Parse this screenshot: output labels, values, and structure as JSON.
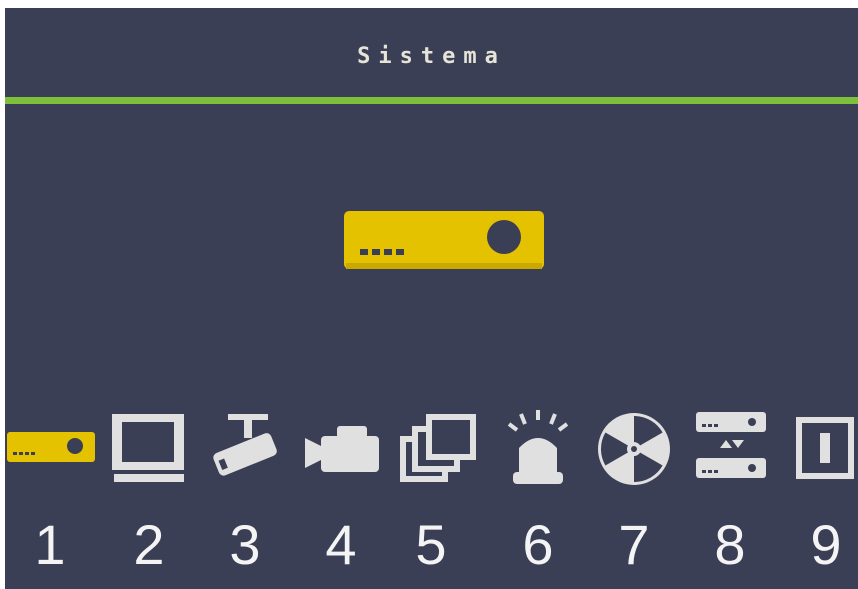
{
  "menu": {
    "title": "Sistema",
    "selected_index": 1,
    "accent_color": "#7ebf3c",
    "selected_color": "#e5c200",
    "items": [
      {
        "number": "1",
        "icon": "dvr-recorder-icon"
      },
      {
        "number": "2",
        "icon": "monitor-icon"
      },
      {
        "number": "3",
        "icon": "cctv-camera-icon"
      },
      {
        "number": "4",
        "icon": "video-camera-icon"
      },
      {
        "number": "5",
        "icon": "multi-screen-icon"
      },
      {
        "number": "6",
        "icon": "alarm-siren-icon"
      },
      {
        "number": "7",
        "icon": "disk-icon"
      },
      {
        "number": "8",
        "icon": "network-devices-icon"
      },
      {
        "number": "9",
        "icon": "exit-icon"
      }
    ]
  }
}
